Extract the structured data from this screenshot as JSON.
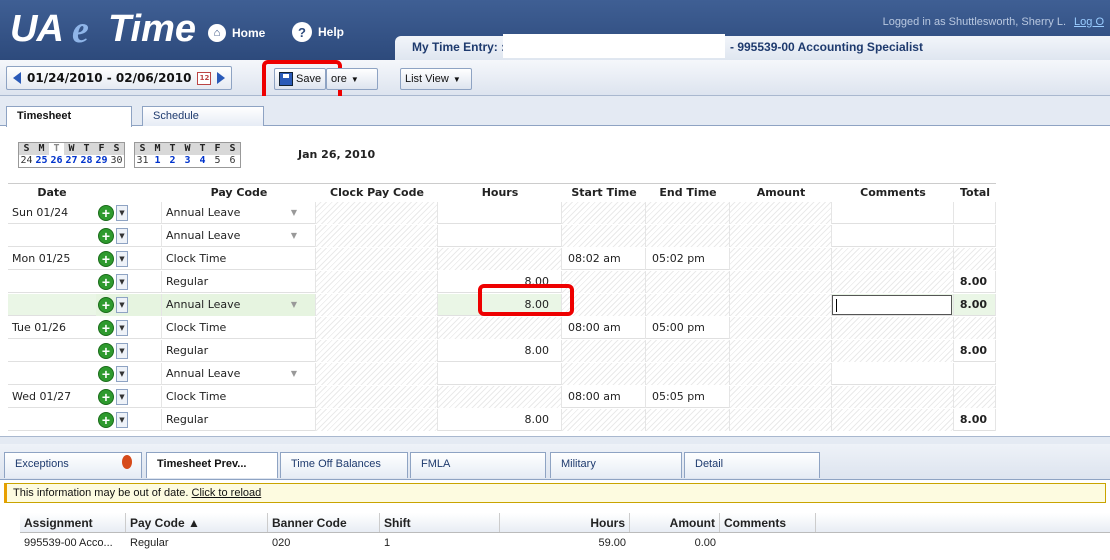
{
  "header": {
    "logo_ua": "UA",
    "logo_e": "e",
    "logo_time": "Time",
    "home_label": "Home",
    "help_label": "Help",
    "logged_in": "Logged in as Shuttlesworth, Sherry L.",
    "logout": "Log O",
    "entry_label": "My Time Entry: :",
    "entry_position": "- 995539-00 Accounting Specialist"
  },
  "toolbar": {
    "date_range": "01/24/2010 - 02/06/2010",
    "save_label": "Save",
    "more_label": "ore",
    "list_view_label": "List View"
  },
  "tabs": [
    {
      "label": "Timesheet",
      "active": true
    },
    {
      "label": "Schedule",
      "active": false
    }
  ],
  "calendar": {
    "week1_days": [
      "S",
      "M",
      "T",
      "W",
      "T",
      "F",
      "S"
    ],
    "week1_dates": [
      "24",
      "25",
      "26",
      "27",
      "28",
      "29",
      "30"
    ],
    "week2_days": [
      "S",
      "M",
      "T",
      "W",
      "T",
      "F",
      "S"
    ],
    "week2_dates": [
      "31",
      "1",
      "2",
      "3",
      "4",
      "5",
      "6"
    ],
    "current_date": "Jan 26, 2010"
  },
  "grid": {
    "columns": [
      "Date",
      "Pay Code",
      "Clock Pay Code",
      "Hours",
      "Start Time",
      "End Time",
      "Amount",
      "Comments",
      "Total"
    ],
    "rows": [
      {
        "date": "Sun 01/24",
        "pay_code": "Annual Leave",
        "hours": "",
        "start": "",
        "end": "",
        "total": ""
      },
      {
        "date": "",
        "pay_code": "Annual Leave",
        "hours": "",
        "start": "",
        "end": "",
        "total": ""
      },
      {
        "date": "Mon 01/25",
        "pay_code": "Clock Time",
        "hours": "",
        "start": "08:02 am",
        "end": "05:02 pm",
        "total": ""
      },
      {
        "date": "",
        "pay_code": "Regular",
        "hours": "8.00",
        "start": "",
        "end": "",
        "total": "8.00"
      },
      {
        "date": "",
        "pay_code": "Annual Leave",
        "hours": "8.00",
        "start": "",
        "end": "",
        "total": "8.00"
      },
      {
        "date": "Tue 01/26",
        "pay_code": "Clock Time",
        "hours": "",
        "start": "08:00 am",
        "end": "05:00 pm",
        "total": ""
      },
      {
        "date": "",
        "pay_code": "Regular",
        "hours": "8.00",
        "start": "",
        "end": "",
        "total": "8.00"
      },
      {
        "date": "",
        "pay_code": "Annual Leave",
        "hours": "",
        "start": "",
        "end": "",
        "total": ""
      },
      {
        "date": "Wed 01/27",
        "pay_code": "Clock Time",
        "hours": "",
        "start": "08:00 am",
        "end": "05:05 pm",
        "total": ""
      },
      {
        "date": "",
        "pay_code": "Regular",
        "hours": "8.00",
        "start": "",
        "end": "",
        "total": "8.00"
      }
    ]
  },
  "bottom_tabs": [
    {
      "label": "Exceptions",
      "active": false
    },
    {
      "label": "Timesheet Prev...",
      "active": true
    },
    {
      "label": "Time Off Balances",
      "active": false
    },
    {
      "label": "FMLA",
      "active": false
    },
    {
      "label": "Military",
      "active": false
    },
    {
      "label": "Detail",
      "active": false
    }
  ],
  "notice": {
    "text": "This information may be out of date.",
    "link": "Click to reload"
  },
  "preview": {
    "columns": [
      "Assignment",
      "Pay Code ▲",
      "Banner Code",
      "Shift",
      "Hours",
      "Amount",
      "Comments"
    ],
    "row": [
      "995539-00 Acco...",
      "Regular",
      "020",
      "1",
      "59.00",
      "0.00",
      ""
    ]
  }
}
